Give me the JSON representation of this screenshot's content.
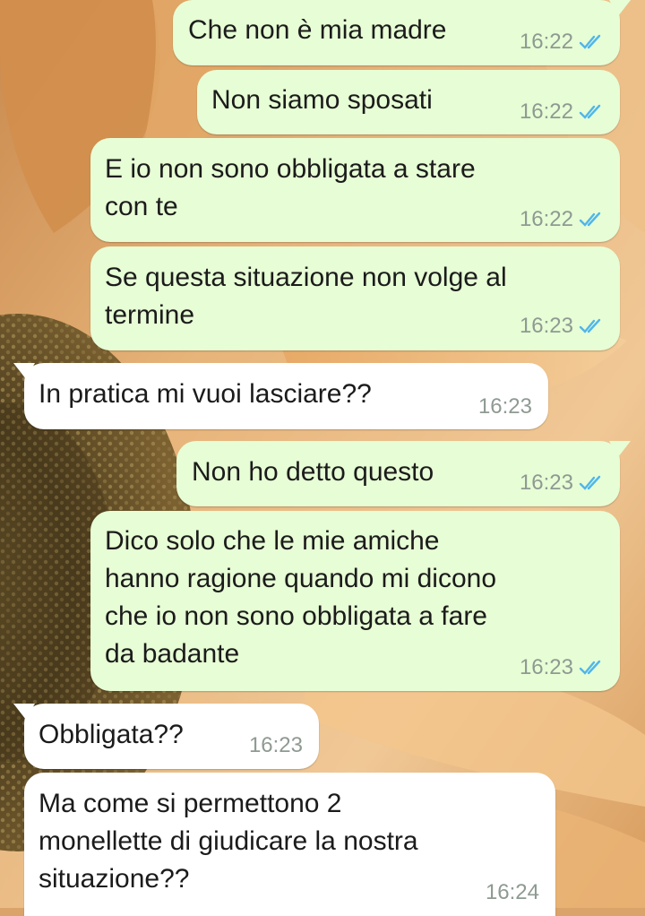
{
  "messages": [
    {
      "direction": "outgoing",
      "text": "Che non è mia madre",
      "time": "16:22",
      "status_icon": "double-check-read-icon"
    },
    {
      "direction": "outgoing",
      "text": "Non siamo sposati",
      "time": "16:22",
      "status_icon": "double-check-read-icon"
    },
    {
      "direction": "outgoing",
      "text": "E io non sono obbligata a stare\ncon te",
      "time": "16:22",
      "status_icon": "double-check-read-icon"
    },
    {
      "direction": "outgoing",
      "text": "Se questa situazione non volge al\ntermine",
      "time": "16:23",
      "status_icon": "double-check-read-icon"
    },
    {
      "direction": "incoming",
      "text": "In pratica mi vuoi lasciare??",
      "time": "16:23"
    },
    {
      "direction": "outgoing",
      "text": "Non ho detto questo",
      "time": "16:23",
      "status_icon": "double-check-read-icon"
    },
    {
      "direction": "outgoing",
      "text": "Dico solo che le mie amiche\nhanno ragione quando mi dicono\nche io non sono obbligata a fare\nda badante",
      "time": "16:23",
      "status_icon": "double-check-read-icon"
    },
    {
      "direction": "incoming",
      "text": "Obbligata??",
      "time": "16:23"
    },
    {
      "direction": "incoming",
      "text": "Ma come si permettono 2\nmonellette di giudicare la nostra\nsituazione??",
      "time": "16:24"
    }
  ],
  "theme": {
    "outgoing_bubble": "#e7fdd5",
    "incoming_bubble": "#ffffff",
    "read_tick_color": "#4fb6ec",
    "time_color": "#8e9a92",
    "wallpaper": "sunflower-photo"
  }
}
